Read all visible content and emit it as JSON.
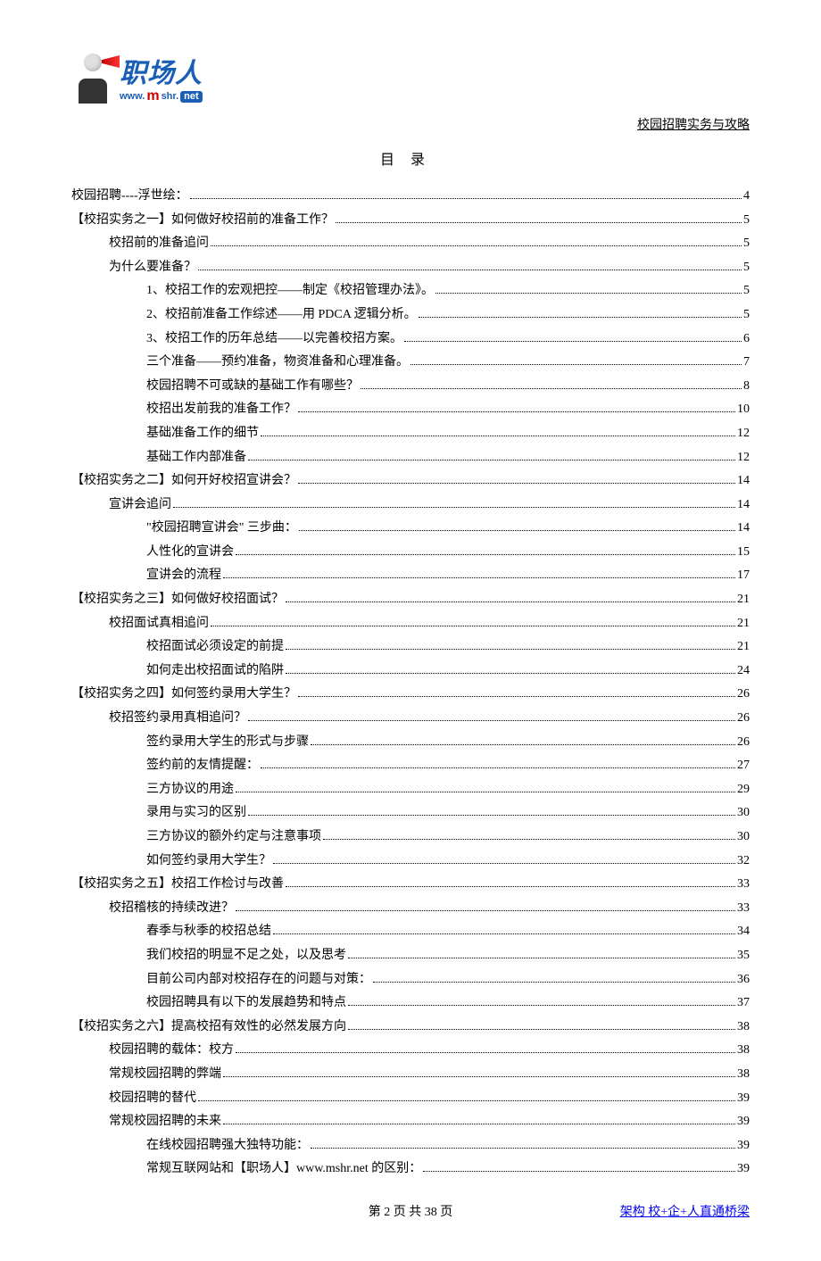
{
  "logo": {
    "cn": "职场人",
    "url_www": "www.",
    "url_m": "m",
    "url_shr": "shr.",
    "url_net": "net"
  },
  "header_right": "校园招聘实务与攻略",
  "toc_title": "目录",
  "toc": [
    {
      "level": 1,
      "label": "校园招聘----浮世绘：",
      "page": "4"
    },
    {
      "level": 1,
      "label": "【校招实务之一】如何做好校招前的准备工作？",
      "page": "5"
    },
    {
      "level": 2,
      "label": "校招前的准备追问",
      "page": "5"
    },
    {
      "level": 2,
      "label": "为什么要准备？",
      "page": "5"
    },
    {
      "level": 3,
      "label": "1、校招工作的宏观把控——制定《校招管理办法》。",
      "page": "5"
    },
    {
      "level": 3,
      "label": "2、校招前准备工作综述——用 PDCA 逻辑分析。",
      "page": "5"
    },
    {
      "level": 3,
      "label": "3、校招工作的历年总结——以完善校招方案。",
      "page": "6"
    },
    {
      "level": 3,
      "label": "三个准备——预约准备，物资准备和心理准备。",
      "page": "7"
    },
    {
      "level": 3,
      "label": "校园招聘不可或缺的基础工作有哪些？",
      "page": "8"
    },
    {
      "level": 3,
      "label": "校招出发前我的准备工作？",
      "page": "10"
    },
    {
      "level": 3,
      "label": "基础准备工作的细节",
      "page": "12"
    },
    {
      "level": 3,
      "label": "基础工作内部准备",
      "page": "12"
    },
    {
      "level": 1,
      "label": "【校招实务之二】如何开好校招宣讲会？",
      "page": "14"
    },
    {
      "level": 2,
      "label": "宣讲会追问",
      "page": "14"
    },
    {
      "level": 3,
      "label": "\"校园招聘宣讲会\" 三步曲：",
      "page": "14"
    },
    {
      "level": 3,
      "label": "人性化的宣讲会",
      "page": "15"
    },
    {
      "level": 3,
      "label": "宣讲会的流程",
      "page": "17"
    },
    {
      "level": 1,
      "label": "【校招实务之三】如何做好校招面试？",
      "page": "21"
    },
    {
      "level": 2,
      "label": "校招面试真相追问",
      "page": "21"
    },
    {
      "level": 3,
      "label": "校招面试必须设定的前提",
      "page": "21"
    },
    {
      "level": 3,
      "label": "如何走出校招面试的陷阱",
      "page": "24"
    },
    {
      "level": 1,
      "label": "【校招实务之四】如何签约录用大学生？",
      "page": "26"
    },
    {
      "level": 2,
      "label": "校招签约录用真相追问？",
      "page": "26"
    },
    {
      "level": 3,
      "label": "签约录用大学生的形式与步骤",
      "page": "26"
    },
    {
      "level": 3,
      "label": "签约前的友情提醒：",
      "page": "27"
    },
    {
      "level": 3,
      "label": "三方协议的用途",
      "page": "29"
    },
    {
      "level": 3,
      "label": "录用与实习的区别",
      "page": "30"
    },
    {
      "level": 3,
      "label": "三方协议的额外约定与注意事项",
      "page": "30"
    },
    {
      "level": 3,
      "label": "如何签约录用大学生？",
      "page": "32"
    },
    {
      "level": 1,
      "label": "【校招实务之五】校招工作检讨与改善",
      "page": "33"
    },
    {
      "level": 2,
      "label": "校招稽核的持续改进？",
      "page": "33"
    },
    {
      "level": 3,
      "label": "春季与秋季的校招总结",
      "page": "34"
    },
    {
      "level": 3,
      "label": "我们校招的明显不足之处，以及思考",
      "page": "35"
    },
    {
      "level": 3,
      "label": "目前公司内部对校招存在的问题与对策：",
      "page": "36"
    },
    {
      "level": 3,
      "label": "校园招聘具有以下的发展趋势和特点",
      "page": "37"
    },
    {
      "level": 1,
      "label": "【校招实务之六】提高校招有效性的必然发展方向",
      "page": "38"
    },
    {
      "level": 2,
      "label": "校园招聘的载体：校方",
      "page": "38"
    },
    {
      "level": 2,
      "label": "常规校园招聘的弊端",
      "page": "38"
    },
    {
      "level": 2,
      "label": "校园招聘的替代",
      "page": "39"
    },
    {
      "level": 2,
      "label": "常规校园招聘的未来",
      "page": "39"
    },
    {
      "level": 3,
      "label": "在线校园招聘强大独特功能：",
      "page": "39"
    },
    {
      "level": 3,
      "label": "常规互联网站和【职场人】www.mshr.net 的区别：",
      "page": "39"
    }
  ],
  "footer": {
    "center": "第 2 页 共 38 页",
    "right": "架构 校+企+人直通桥梁"
  }
}
